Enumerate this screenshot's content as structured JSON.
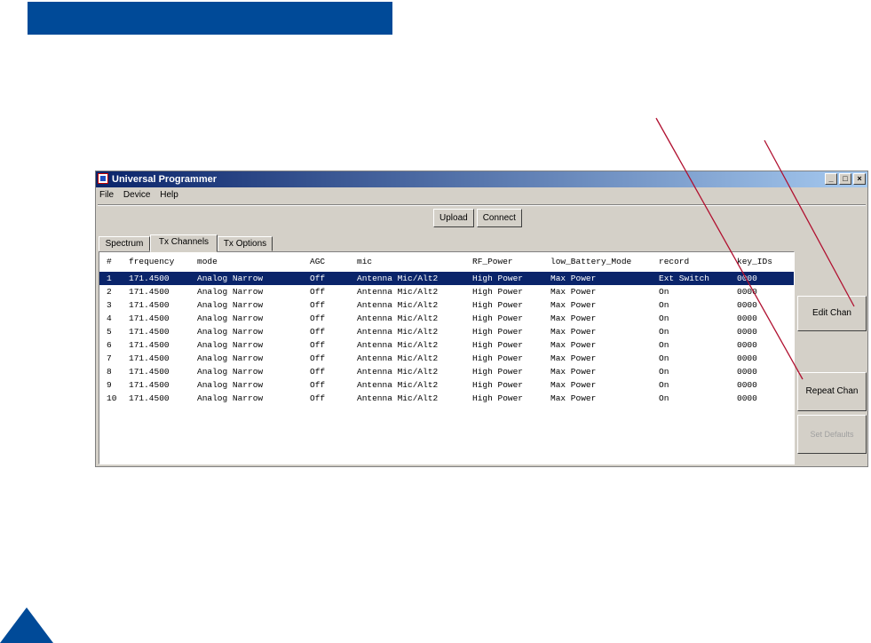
{
  "colors": {
    "brand_blue": "#004a98",
    "annotation_red": "#b01030",
    "selection": "#0a246a",
    "window_face": "#d4d0c8"
  },
  "window": {
    "title": "Universal Programmer",
    "icon": "app-icon",
    "controls": [
      "minimize-icon",
      "maximize-icon",
      "close-icon"
    ],
    "controls_glyphs": [
      "_",
      "□",
      "×"
    ]
  },
  "menu": [
    "File",
    "Device",
    "Help"
  ],
  "toolbar": {
    "upload_label": "Upload",
    "connect_label": "Connect"
  },
  "tabs": [
    {
      "label": "Spectrum",
      "active": false
    },
    {
      "label": "Tx Channels",
      "active": true
    },
    {
      "label": "Tx Options",
      "active": false
    }
  ],
  "table": {
    "columns": [
      "#",
      "frequency",
      "mode",
      "AGC",
      "mic",
      "RF_Power",
      "low_Battery_Mode",
      "record",
      "key_IDs"
    ],
    "selected_row": 0,
    "rows": [
      [
        "1",
        "171.4500",
        "Analog Narrow",
        "Off",
        "Antenna Mic/Alt2",
        "High Power",
        "Max Power",
        "Ext Switch",
        "0000"
      ],
      [
        "2",
        "171.4500",
        "Analog Narrow",
        "Off",
        "Antenna Mic/Alt2",
        "High Power",
        "Max Power",
        "On",
        "0000"
      ],
      [
        "3",
        "171.4500",
        "Analog Narrow",
        "Off",
        "Antenna Mic/Alt2",
        "High Power",
        "Max Power",
        "On",
        "0000"
      ],
      [
        "4",
        "171.4500",
        "Analog Narrow",
        "Off",
        "Antenna Mic/Alt2",
        "High Power",
        "Max Power",
        "On",
        "0000"
      ],
      [
        "5",
        "171.4500",
        "Analog Narrow",
        "Off",
        "Antenna Mic/Alt2",
        "High Power",
        "Max Power",
        "On",
        "0000"
      ],
      [
        "6",
        "171.4500",
        "Analog Narrow",
        "Off",
        "Antenna Mic/Alt2",
        "High Power",
        "Max Power",
        "On",
        "0000"
      ],
      [
        "7",
        "171.4500",
        "Analog Narrow",
        "Off",
        "Antenna Mic/Alt2",
        "High Power",
        "Max Power",
        "On",
        "0000"
      ],
      [
        "8",
        "171.4500",
        "Analog Narrow",
        "Off",
        "Antenna Mic/Alt2",
        "High Power",
        "Max Power",
        "On",
        "0000"
      ],
      [
        "9",
        "171.4500",
        "Analog Narrow",
        "Off",
        "Antenna Mic/Alt2",
        "High Power",
        "Max Power",
        "On",
        "0000"
      ],
      [
        "10",
        "171.4500",
        "Analog Narrow",
        "Off",
        "Antenna Mic/Alt2",
        "High Power",
        "Max Power",
        "On",
        "0000"
      ]
    ]
  },
  "side_buttons": {
    "edit_chan": "Edit Chan",
    "repeat_chan": "Repeat Chan",
    "set_defaults": "Set Defaults"
  }
}
